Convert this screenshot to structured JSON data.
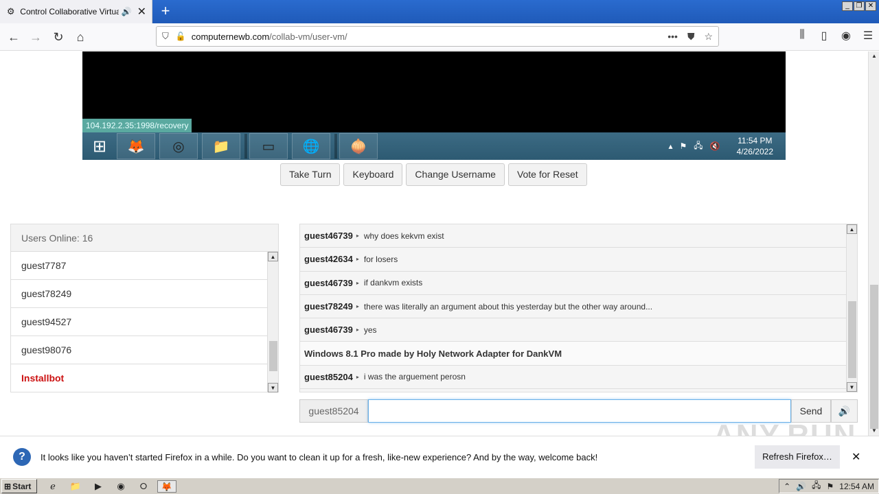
{
  "browser": {
    "tab_title": "Control Collaborative Virtual M",
    "url_domain": "computernewb.com",
    "url_path": "/collab-vm/user-vm/"
  },
  "vm": {
    "status_link": "104.192.2.35:1998/recovery",
    "clock_time": "11:54 PM",
    "clock_date": "4/26/2022"
  },
  "vm_buttons": {
    "take_turn": "Take Turn",
    "keyboard": "Keyboard",
    "change_username": "Change Username",
    "vote_reset": "Vote for Reset"
  },
  "users": {
    "header": "Users Online: 16",
    "list": [
      {
        "name": "guest7787"
      },
      {
        "name": "guest78249"
      },
      {
        "name": "guest94527"
      },
      {
        "name": "guest98076"
      },
      {
        "name": "Installbot"
      }
    ]
  },
  "chat": {
    "messages": [
      {
        "user": "guest46739",
        "text": "why does kekvm exist"
      },
      {
        "user": "guest42634",
        "text": "for losers"
      },
      {
        "user": "guest46739",
        "text": "if dankvm exists"
      },
      {
        "user": "guest78249",
        "text": "there was literally an argument about this yesterday but the other way around..."
      },
      {
        "user": "guest46739",
        "text": "yes"
      },
      {
        "system": "Windows 8.1 Pro made by Holy Network Adapter for DankVM"
      },
      {
        "user": "guest85204",
        "text": "i was the arguement perosn"
      }
    ],
    "username": "guest85204",
    "input_value": "",
    "send_label": "Send"
  },
  "watermark": "ANY.RUN",
  "notification": {
    "text": "It looks like you haven’t started Firefox in a while. Do you want to clean it up for a fresh, like-new experience? And by the way, welcome back!",
    "refresh_label": "Refresh Firefox…"
  },
  "taskbar": {
    "start_label": "Start",
    "clock": "12:54 AM"
  }
}
